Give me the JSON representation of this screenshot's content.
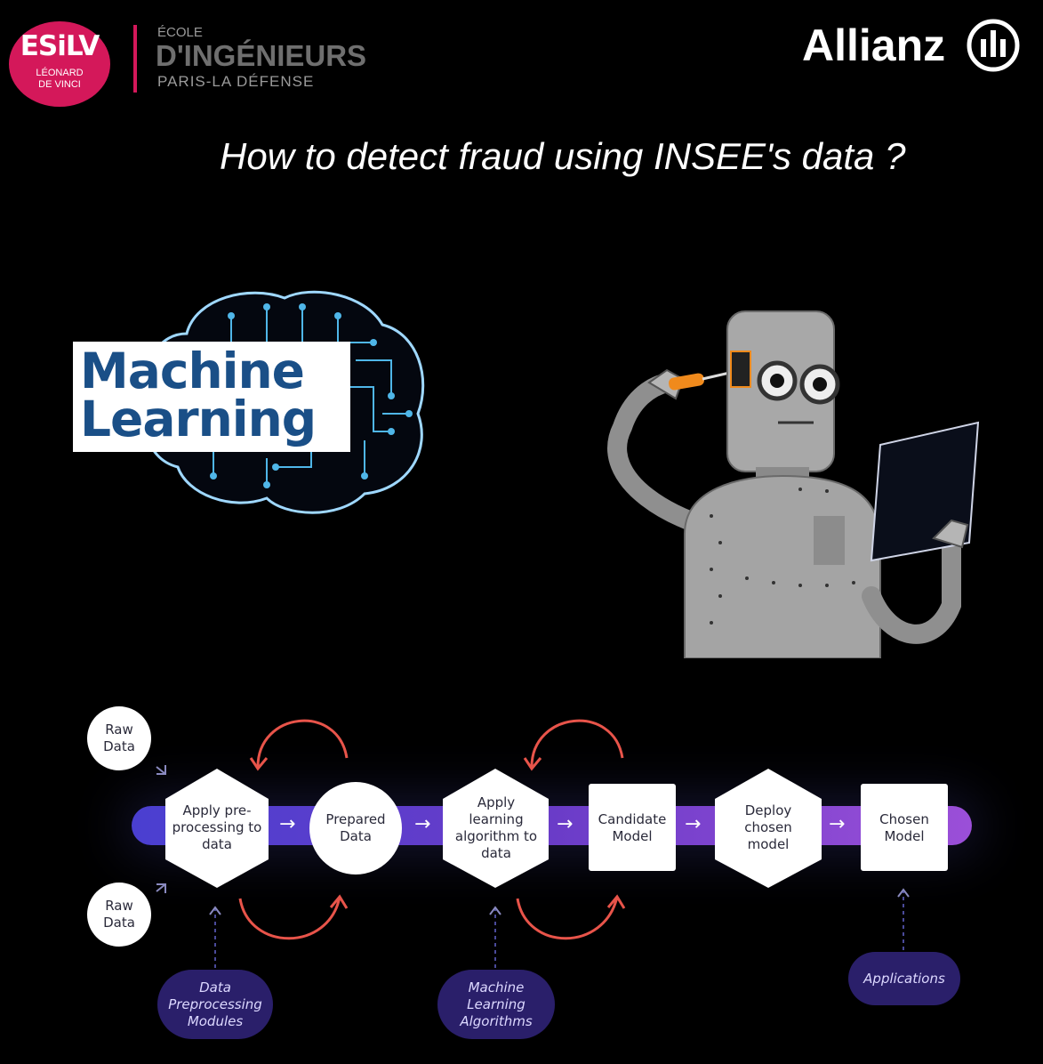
{
  "header": {
    "esilv": {
      "word": "ESiLV",
      "line1": "LÉONARD",
      "line2": "DE VINCI",
      "color": "#d4185a"
    },
    "school": {
      "ecole": "ÉCOLE",
      "name": "D'INGÉNIEURS",
      "location": "PARIS-LA DÉFENSE"
    },
    "partner": {
      "name": "Allianz",
      "icon": "allianz-eagle-icon"
    }
  },
  "title": "How to detect fraud using INSEE's data ?",
  "ml_badge": {
    "line1": "Machine",
    "line2": "Learning",
    "color": "#1a4f87",
    "icon": "brain-circuit-icon"
  },
  "illustration": {
    "icon": "robot-reading-icon"
  },
  "process": {
    "raw_top": "Raw Data",
    "raw_bottom": "Raw Data",
    "steps": [
      {
        "label": "Apply pre-processing to data",
        "shape": "hexagon"
      },
      {
        "label": "Prepared Data",
        "shape": "circle"
      },
      {
        "label": "Apply learning algorithm to data",
        "shape": "hexagon"
      },
      {
        "label": "Candidate Model",
        "shape": "square"
      },
      {
        "label": "Deploy chosen model",
        "shape": "hexagon"
      },
      {
        "label": "Chosen Model",
        "shape": "square"
      }
    ],
    "arrow": "→",
    "inputs": [
      {
        "label": "Data Preprocessing Modules"
      },
      {
        "label": "Machine Learning Algorithms"
      },
      {
        "label": "Applications"
      }
    ],
    "colors": {
      "bar_start": "#4a3fd0",
      "bar_end": "#9b4fd8",
      "loop_arrow": "#e8544a",
      "pill": "#2a1f6a"
    }
  }
}
